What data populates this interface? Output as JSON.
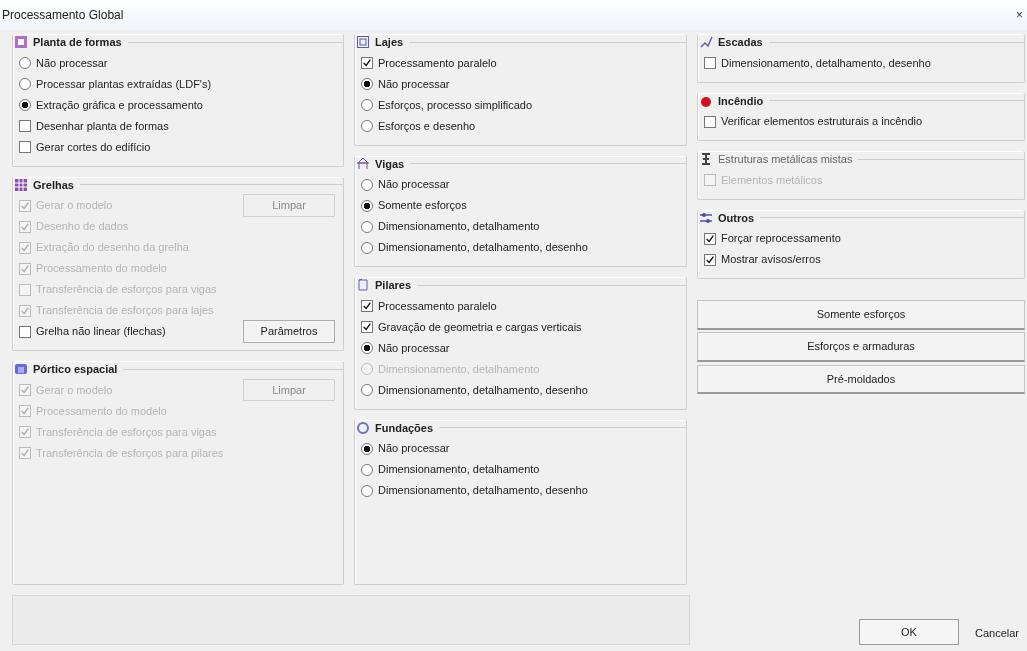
{
  "window": {
    "title": "Processamento Global",
    "close": "×"
  },
  "columns": [
    {
      "groups": [
        {
          "title": "Planta de formas",
          "disabled": false,
          "items": [
            {
              "kind": "radio",
              "label": "Não processar",
              "selected": false,
              "disabled": false
            },
            {
              "kind": "radio",
              "label": "Processar plantas extraídas (LDF's)",
              "selected": false,
              "disabled": false
            },
            {
              "kind": "radio",
              "label": "Extração gráfica e processamento",
              "selected": true,
              "disabled": false
            },
            {
              "kind": "checkbox",
              "label": "Desenhar planta de formas",
              "checked": false,
              "disabled": false
            },
            {
              "kind": "checkbox",
              "label": "Gerar cortes do edifício",
              "checked": false,
              "disabled": false
            }
          ]
        },
        {
          "title": "Grelhas",
          "disabled": false,
          "items": [
            {
              "kind": "checkbox",
              "label": "Gerar o modelo",
              "checked": true,
              "disabled": true,
              "button": {
                "label": "Limpar",
                "disabled": true
              }
            },
            {
              "kind": "checkbox",
              "label": "Desenho de dados",
              "checked": true,
              "disabled": true
            },
            {
              "kind": "checkbox",
              "label": "Extração do desenho da grelha",
              "checked": true,
              "disabled": true
            },
            {
              "kind": "checkbox",
              "label": "Processamento do modelo",
              "checked": true,
              "disabled": true
            },
            {
              "kind": "checkbox",
              "label": "Transferência de esforços para vigas",
              "checked": false,
              "disabled": true
            },
            {
              "kind": "checkbox",
              "label": "Transferência de esforços para lajes",
              "checked": true,
              "disabled": true
            },
            {
              "kind": "checkbox",
              "label": "Grelha não linear (flechas)",
              "checked": false,
              "disabled": false,
              "button": {
                "label": "Parâmetros",
                "disabled": false
              }
            }
          ]
        },
        {
          "title": "Pórtico espacial",
          "disabled": false,
          "items": [
            {
              "kind": "checkbox",
              "label": "Gerar o modelo",
              "checked": true,
              "disabled": true,
              "button": {
                "label": "Limpar",
                "disabled": true
              }
            },
            {
              "kind": "checkbox",
              "label": "Processamento do modelo",
              "checked": true,
              "disabled": true
            },
            {
              "kind": "checkbox",
              "label": "Transferência de esforços para vigas",
              "checked": true,
              "disabled": true
            },
            {
              "kind": "checkbox",
              "label": "Transferência de esforços para pilares",
              "checked": true,
              "disabled": true
            }
          ]
        }
      ]
    },
    {
      "groups": [
        {
          "title": "Lajes",
          "disabled": false,
          "items": [
            {
              "kind": "checkbox",
              "label": "Processamento paralelo",
              "checked": true,
              "disabled": false
            },
            {
              "kind": "radio",
              "label": "Não processar",
              "selected": true,
              "disabled": false
            },
            {
              "kind": "radio",
              "label": "Esforços, processo simplificado",
              "selected": false,
              "disabled": false
            },
            {
              "kind": "radio",
              "label": "Esforços e desenho",
              "selected": false,
              "disabled": false
            }
          ]
        },
        {
          "title": "Vigas",
          "disabled": false,
          "items": [
            {
              "kind": "radio",
              "label": "Não processar",
              "selected": false,
              "disabled": false
            },
            {
              "kind": "radio",
              "label": "Somente esforços",
              "selected": true,
              "disabled": false
            },
            {
              "kind": "radio",
              "label": "Dimensionamento, detalhamento",
              "selected": false,
              "disabled": false
            },
            {
              "kind": "radio",
              "label": "Dimensionamento, detalhamento, desenho",
              "selected": false,
              "disabled": false
            }
          ]
        },
        {
          "title": "Pilares",
          "disabled": false,
          "items": [
            {
              "kind": "checkbox",
              "label": "Processamento paralelo",
              "checked": true,
              "disabled": false
            },
            {
              "kind": "checkbox",
              "label": "Gravação de geometria e cargas verticais",
              "checked": true,
              "disabled": false
            },
            {
              "kind": "radio",
              "label": "Não processar",
              "selected": true,
              "disabled": false
            },
            {
              "kind": "radio",
              "label": "Dimensionamento, detalhamento",
              "selected": false,
              "disabled": true
            },
            {
              "kind": "radio",
              "label": "Dimensionamento, detalhamento, desenho",
              "selected": false,
              "disabled": false
            }
          ]
        },
        {
          "title": "Fundações",
          "disabled": false,
          "items": [
            {
              "kind": "radio",
              "label": "Não processar",
              "selected": true,
              "disabled": false
            },
            {
              "kind": "radio",
              "label": "Dimensionamento, detalhamento",
              "selected": false,
              "disabled": false
            },
            {
              "kind": "radio",
              "label": "Dimensionamento, detalhamento, desenho",
              "selected": false,
              "disabled": false
            }
          ]
        }
      ]
    },
    {
      "groups": [
        {
          "title": "Escadas",
          "disabled": false,
          "items": [
            {
              "kind": "checkbox",
              "label": "Dimensionamento, detalhamento, desenho",
              "checked": false,
              "disabled": false
            }
          ]
        },
        {
          "title": "Incêndio",
          "disabled": false,
          "items": [
            {
              "kind": "checkbox",
              "label": "Verificar elementos estruturais a incêndio",
              "checked": false,
              "disabled": false
            }
          ]
        },
        {
          "title": "Estruturas metálicas mistas",
          "disabled": true,
          "items": [
            {
              "kind": "checkbox",
              "label": "Elementos metálicos",
              "checked": false,
              "disabled": true
            }
          ]
        },
        {
          "title": "Outros",
          "disabled": false,
          "items": [
            {
              "kind": "checkbox",
              "label": "Forçar reprocessamento",
              "checked": true,
              "disabled": false
            },
            {
              "kind": "checkbox",
              "label": "Mostrar avisos/erros",
              "checked": true,
              "disabled": false
            }
          ]
        }
      ]
    }
  ],
  "action_buttons": [
    "Somente esforços",
    "Esforços e armaduras",
    "Pré-moldados"
  ],
  "footer_buttons": [
    {
      "label": "OK",
      "kind": "default"
    },
    {
      "label": "Cancelar",
      "kind": "flat"
    }
  ]
}
